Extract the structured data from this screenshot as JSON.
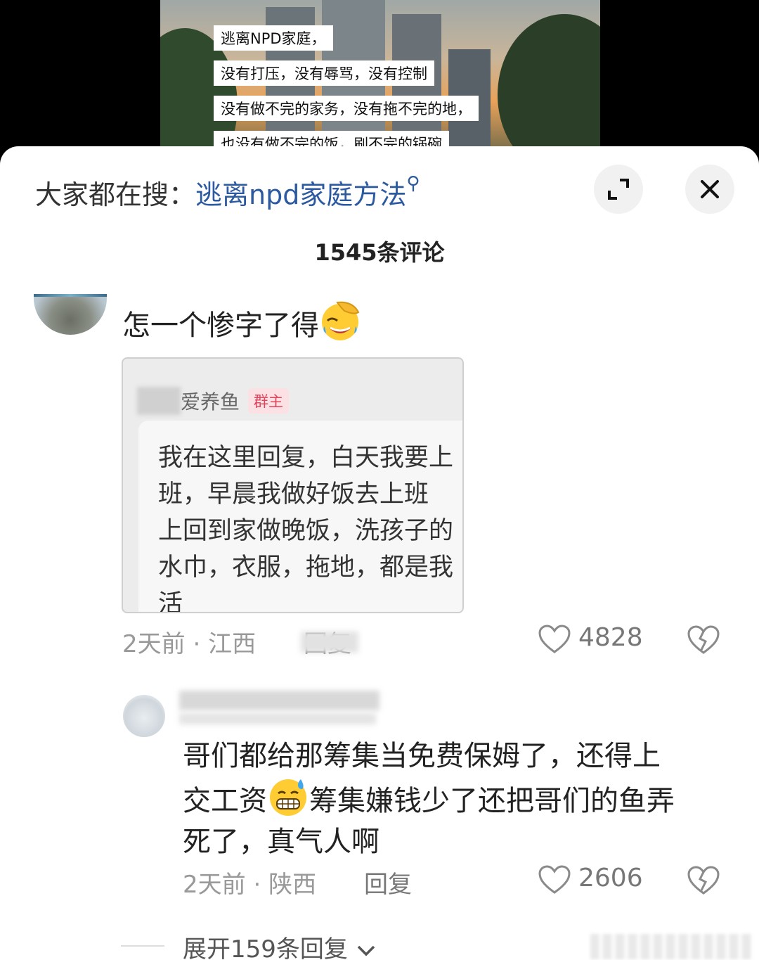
{
  "video": {
    "captions": [
      "逃离NPD家庭，",
      "没有打压，没有辱骂，没有控制",
      "没有做不完的家务，没有拖不完的地，",
      "也没有做不完的饭，刷不完的锅碗"
    ]
  },
  "sheet": {
    "search_prefix": "大家都在搜：",
    "search_term": "逃离npd家庭方法",
    "search_icon_glyph": "⚲",
    "comment_count": "1545条评论"
  },
  "comment1": {
    "text": "怎一个惨字了得",
    "emoji": "facepalm-laughing-emoji",
    "quote": {
      "name": "爱养鱼",
      "badge": "群主",
      "lines": [
        "我在这里回复，白天我要上",
        "班，早晨我做好饭去上班",
        "上回到家做晚饭，洗孩子的",
        "水巾，衣服，拖地，都是我",
        "活"
      ]
    },
    "time": "2天前",
    "separator": "·",
    "location": "江西",
    "reply_label": "回复",
    "likes": "4828"
  },
  "reply1": {
    "lines": [
      "哥们都给那筹集当免费保姆了，还得上",
      "交工资",
      "筹集嫌钱少了还把哥们的鱼弄",
      "死了，真气人啊"
    ],
    "emoji": "grimacing-sweat-emoji",
    "time": "2天前",
    "separator": "·",
    "location": "陕西",
    "reply_label": "回复",
    "likes": "2606"
  },
  "expand": {
    "label": "展开159条回复"
  },
  "colors": {
    "link": "#2c5aa0",
    "badge_text": "#e0445c",
    "badge_bg": "#fbe1e4"
  }
}
